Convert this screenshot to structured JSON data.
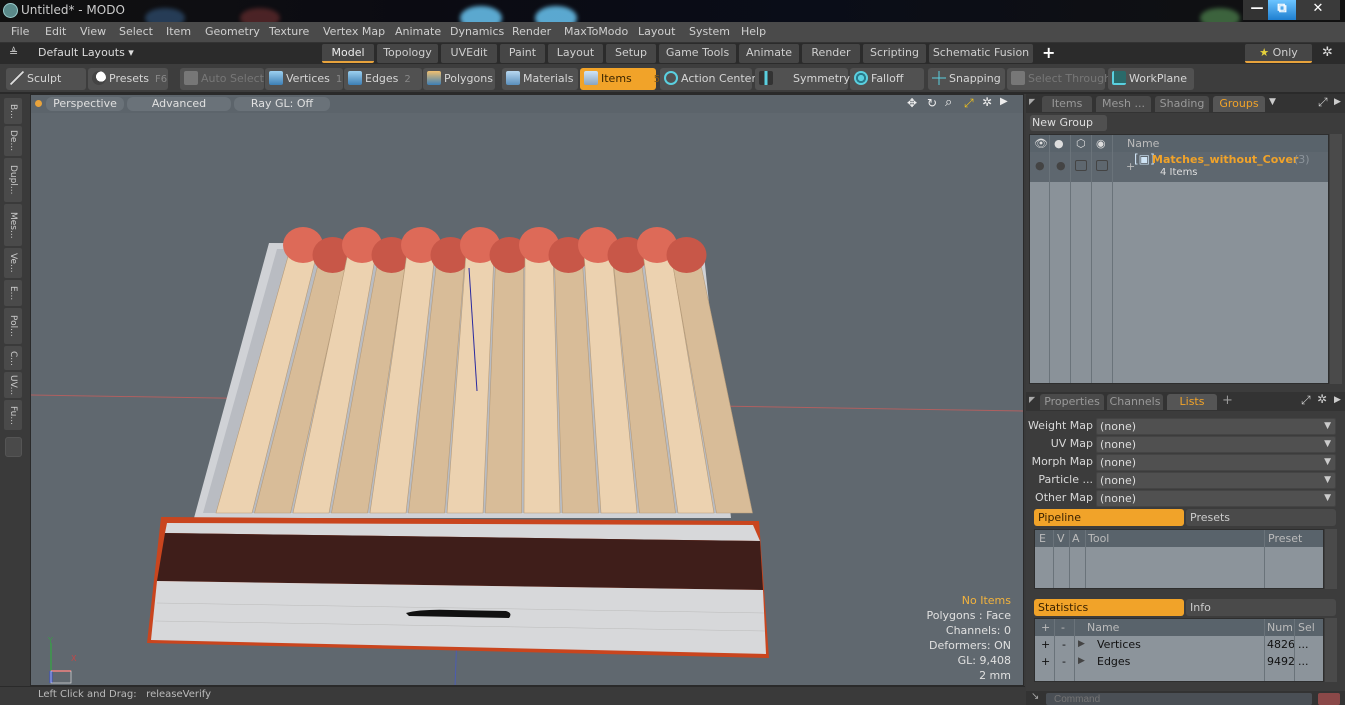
{
  "window": {
    "title": "Untitled* - MODO",
    "controls": {
      "minimize": "—",
      "restore": "⧉",
      "close": "✕"
    }
  },
  "menu": [
    "File",
    "Edit",
    "View",
    "Select",
    "Item",
    "Geometry",
    "Texture",
    "Vertex Map",
    "Animate",
    "Dynamics",
    "Render",
    "MaxToModo",
    "Layout",
    "System",
    "Help"
  ],
  "layout_bar": {
    "layouts_label": "Default Layouts ▾",
    "tabs": [
      "Model",
      "Topology",
      "UVEdit",
      "Paint",
      "Layout",
      "Setup",
      "Game Tools",
      "Animate",
      "Render",
      "Scripting",
      "Schematic Fusion"
    ],
    "active_tab": "Model",
    "add_label": "+",
    "only_label": "Only",
    "star": "★"
  },
  "toolbar": {
    "sculpt": "Sculpt",
    "presets": "Presets",
    "presets_key": "F6",
    "auto_select": "Auto Select",
    "vertices": "Vertices",
    "vertices_key": "1",
    "edges": "Edges",
    "edges_key": "2",
    "polygons": "Polygons",
    "materials": "Materials",
    "items": "Items",
    "items_key": "5",
    "action_center": "Action Center",
    "symmetry": "Symmetry",
    "falloff": "Falloff",
    "snapping": "Snapping",
    "select_through": "Select Through",
    "workplane": "WorkPlane"
  },
  "left_tabs": [
    "B...",
    "De...",
    "Dupl...",
    "Mes...",
    "Ve...",
    "E...",
    "Pol...",
    "C...",
    "UV...",
    "Fu..."
  ],
  "viewport": {
    "view_mode": "Perspective",
    "shading": "Advanced",
    "raygl": "Ray GL: Off",
    "info": {
      "selection": "No Items",
      "polygons": "Polygons : Face",
      "channels": "Channels: 0",
      "deformers": "Deformers: ON",
      "gl": "GL: 9,408",
      "unit": "2 mm"
    },
    "axis": {
      "x": "X",
      "y": "Y",
      "z": "Z"
    }
  },
  "groups_panel": {
    "tabs": [
      "Items",
      "Mesh ...",
      "Shading",
      "Groups"
    ],
    "active_tab": "Groups",
    "new_group": "New Group",
    "columns": {
      "name": "Name"
    },
    "rows": [
      {
        "name": "Matches_without_Cover",
        "count": "(3)",
        "more": "...",
        "sub": "4 Items"
      }
    ]
  },
  "lists_panel": {
    "tabs": [
      "Properties",
      "Channels",
      "Lists"
    ],
    "active_tab": "Lists",
    "add": "+",
    "maps": [
      {
        "label": "Weight Map",
        "value": "(none)"
      },
      {
        "label": "UV Map",
        "value": "(none)"
      },
      {
        "label": "Morph Map",
        "value": "(none)"
      },
      {
        "label": "Particle  ...",
        "value": "(none)"
      },
      {
        "label": "Other Map",
        "value": "(none)"
      }
    ]
  },
  "pipeline": {
    "tabs": [
      "Pipeline",
      "Presets"
    ],
    "active_tab": "Pipeline",
    "columns": [
      "E",
      "V",
      "A",
      "Tool",
      "Preset"
    ]
  },
  "statistics": {
    "tabs": [
      "Statistics",
      "Info"
    ],
    "active_tab": "Statistics",
    "columns": [
      "+",
      "-",
      "Name",
      "Num",
      "Sel"
    ],
    "rows": [
      {
        "plus": "+",
        "minus": "-",
        "name": "Vertices",
        "num": "4826",
        "sel": "..."
      },
      {
        "plus": "+",
        "minus": "-",
        "name": "Edges",
        "num": "9492",
        "sel": "..."
      }
    ]
  },
  "command": {
    "placeholder": "Command"
  },
  "status": {
    "text": "Left Click and Drag:   releaseVerify"
  },
  "colors": {
    "accent": "#f1a329",
    "viewport_bg": "#60686f",
    "panel_bg": "#3c3c3c"
  }
}
